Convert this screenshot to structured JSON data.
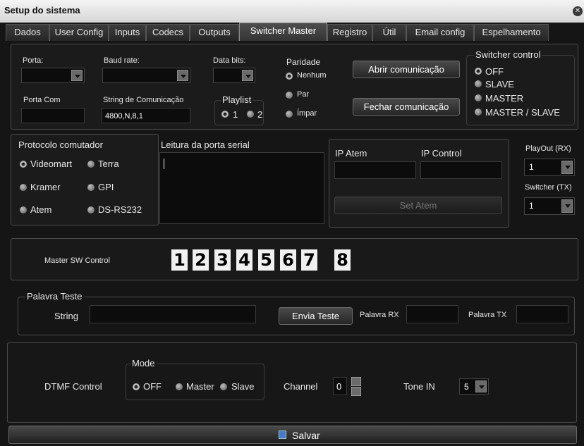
{
  "window": {
    "title": "Setup do sistema",
    "close_glyph": "✕"
  },
  "tabs": [
    "Dados",
    "User Config",
    "Inputs",
    "Codecs",
    "Outputs",
    "Switcher Master",
    "Registro",
    "Útil",
    "Email config",
    "Espelhamento"
  ],
  "active_tab": "Switcher Master",
  "serial": {
    "porta_label": "Porta:",
    "baud_label": "Baud rate:",
    "databits_label": "Data bits:",
    "porta_com_label": "Porta  Com",
    "string_label": "String de Comunicação",
    "string_value": "4800,N,8,1",
    "paridade_label": "Paridade",
    "paridade_options": [
      "Nenhum",
      "Par",
      "Ímpar"
    ],
    "playlist_label": "Playlist",
    "playlist_options": [
      "1",
      "2"
    ],
    "abrir_button": "Abrir comunicação",
    "fechar_button": "Fechar comunicação"
  },
  "switcher_control": {
    "label": "Switcher control",
    "options": [
      "OFF",
      "SLAVE",
      "MASTER",
      "MASTER / SLAVE"
    ]
  },
  "protocolo": {
    "label": "Protocolo  comutador",
    "options": [
      "Videomart",
      "Terra",
      "Kramer",
      "GPI",
      "Atem",
      "DS-RS232"
    ]
  },
  "leitura": {
    "label": "Leitura da porta serial"
  },
  "atem": {
    "ip_atem_label": "IP Atem",
    "ip_control_label": "IP Control",
    "set_button": "Set Atem"
  },
  "playout": {
    "label": "PlayOut  (RX)",
    "value": "1",
    "switcher_label": "Switcher (TX)",
    "switcher_value": "1"
  },
  "master_sw": {
    "label": "Master SW Control",
    "buttons": [
      "1",
      "2",
      "3",
      "4",
      "5",
      "6",
      "7",
      "8"
    ]
  },
  "palavra": {
    "group_label": "Palavra Teste",
    "string_label": "String",
    "envia_button": "Envia Teste",
    "rx_label": "Palavra RX",
    "tx_label": "Palavra TX"
  },
  "dtmf": {
    "label": "DTMF Control",
    "mode_label": "Mode",
    "modes": [
      "OFF",
      "Master",
      "Slave"
    ],
    "channel_label": "Channel",
    "channel_value": "0",
    "tone_label": "Tone IN",
    "tone_value": "5"
  },
  "save_button": "Salvar",
  "colors": {
    "background": "#151515",
    "panel": "#1b1b1b",
    "field": "#0c0c0c",
    "title_bar": "#e4e4e4"
  }
}
